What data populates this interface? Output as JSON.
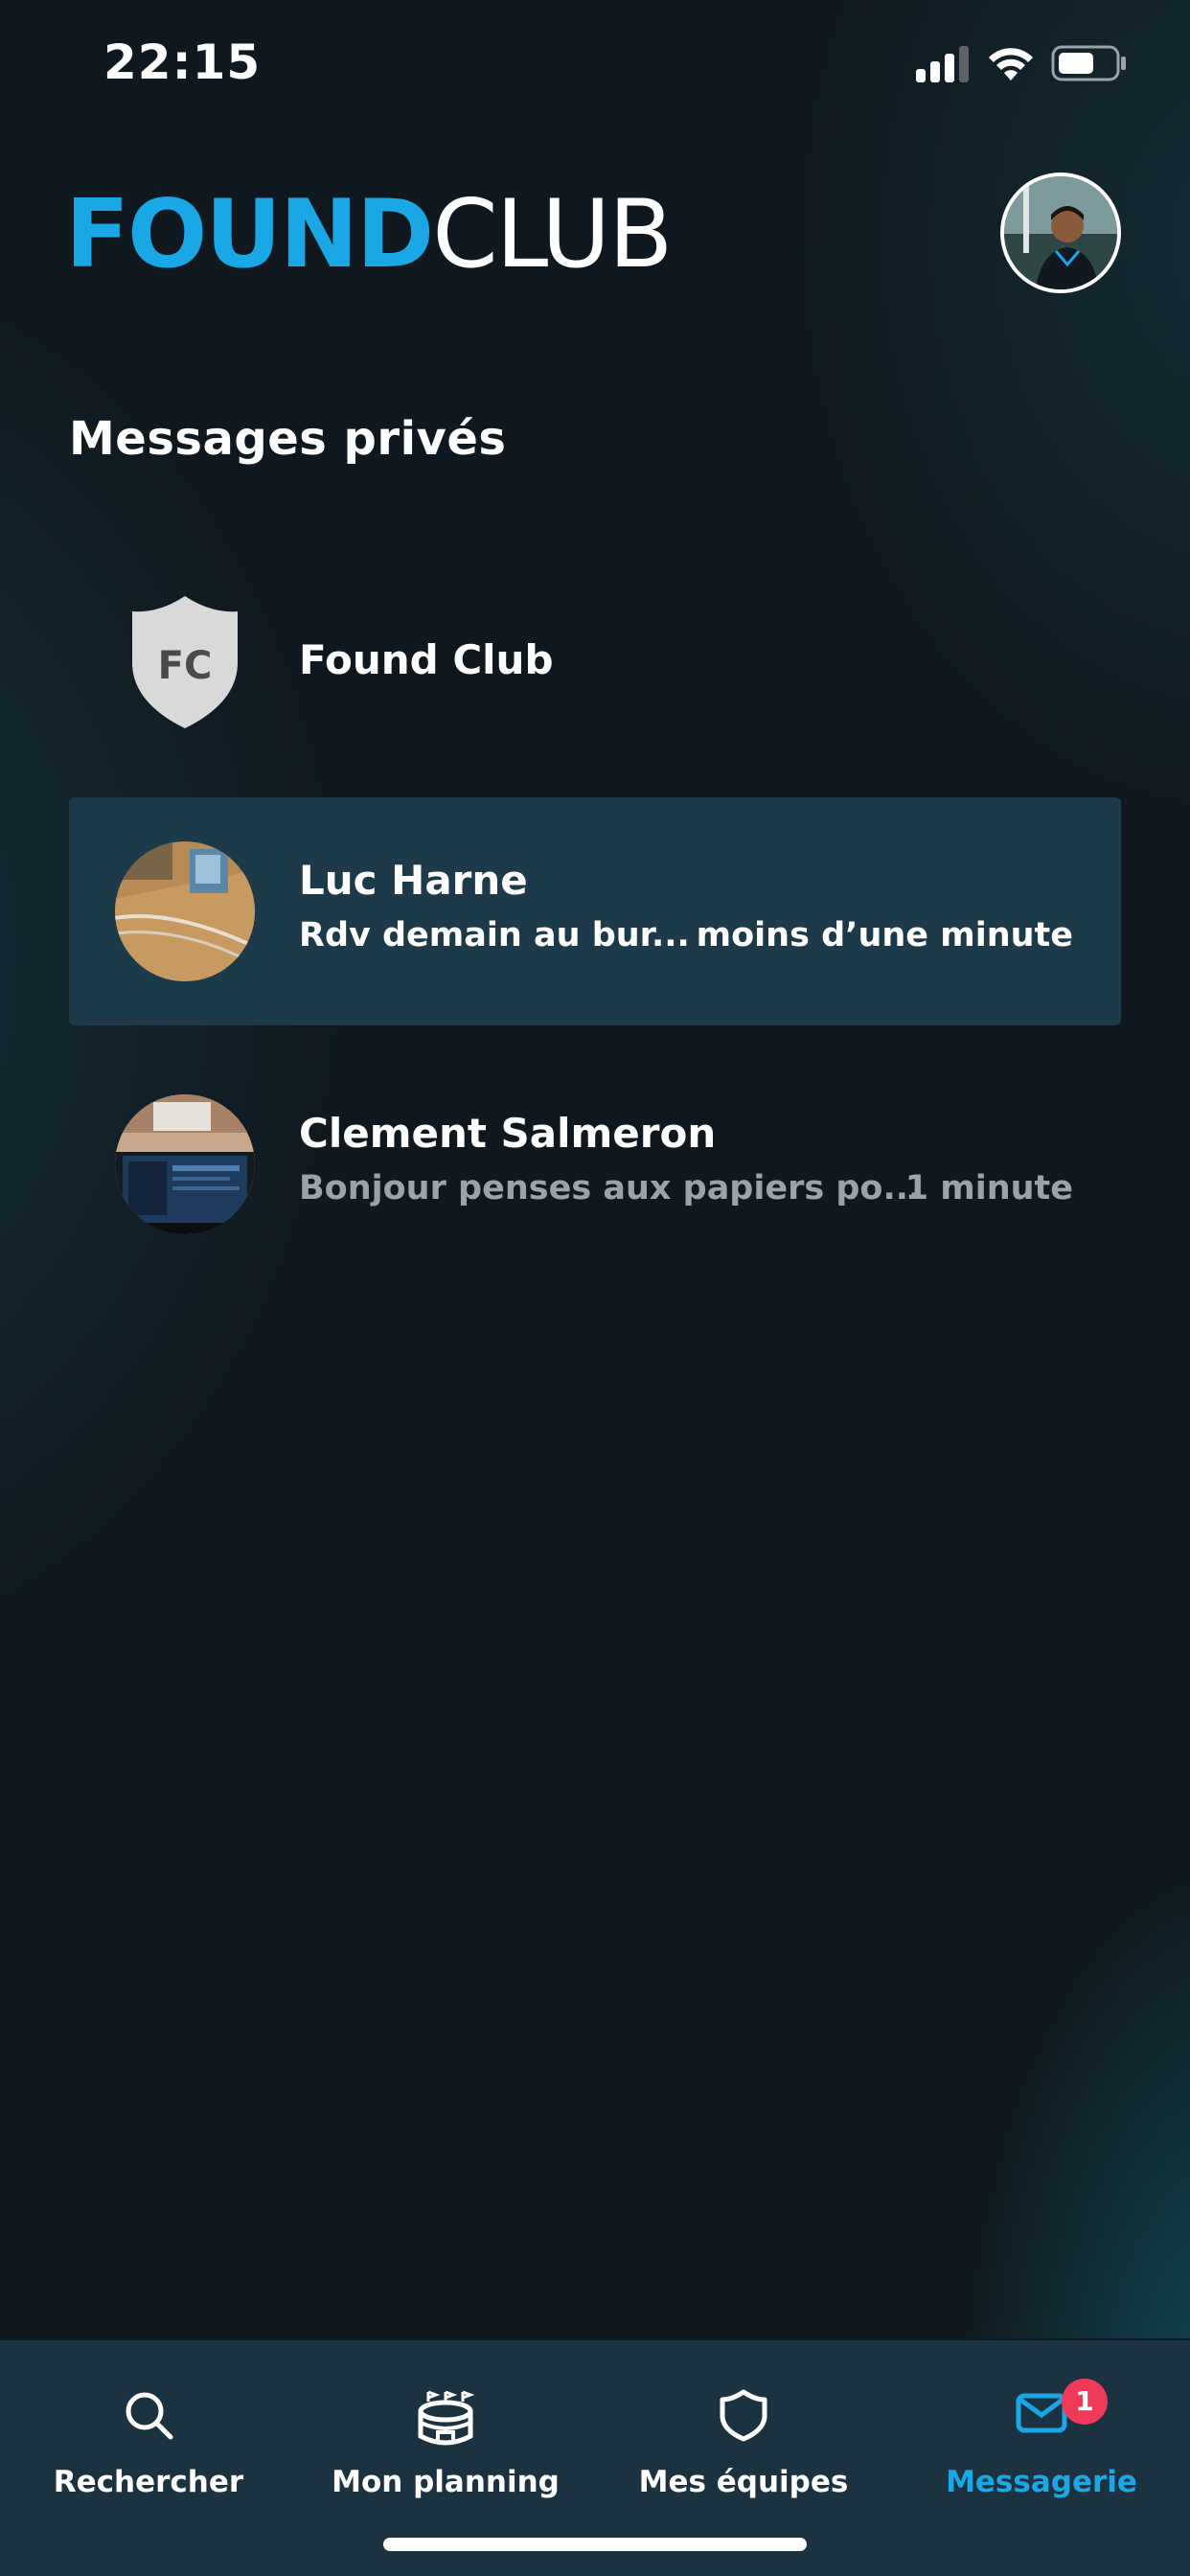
{
  "status_bar": {
    "time": "22:15"
  },
  "header": {
    "logo_bold": "FOUND",
    "logo_light": "CLUB"
  },
  "page": {
    "title": "Messages privés"
  },
  "conversations": [
    {
      "name": "Found Club",
      "preview": "",
      "time": "",
      "avatar": "fc-shield-logo",
      "avatar_text": "FC",
      "selected": false
    },
    {
      "name": "Luc Harne",
      "preview": "Rdv demain au bur...",
      "time": "moins d’une minute",
      "avatar": "photo",
      "selected": true
    },
    {
      "name": "Clement Salmeron",
      "preview": "Bonjour penses aux papiers po...",
      "time": "1 minute",
      "avatar": "photo",
      "selected": false
    }
  ],
  "nav": {
    "items": [
      {
        "label": "Rechercher",
        "icon": "search-icon"
      },
      {
        "label": "Mon planning",
        "icon": "stadium-icon"
      },
      {
        "label": "Mes équipes",
        "icon": "shield-icon"
      },
      {
        "label": "Messagerie",
        "icon": "mail-icon",
        "badge": "1",
        "active": true
      }
    ]
  },
  "colors": {
    "accent": "#1aa7e6",
    "badge": "#f03a5b",
    "selected_row": "#1c3a4a"
  }
}
